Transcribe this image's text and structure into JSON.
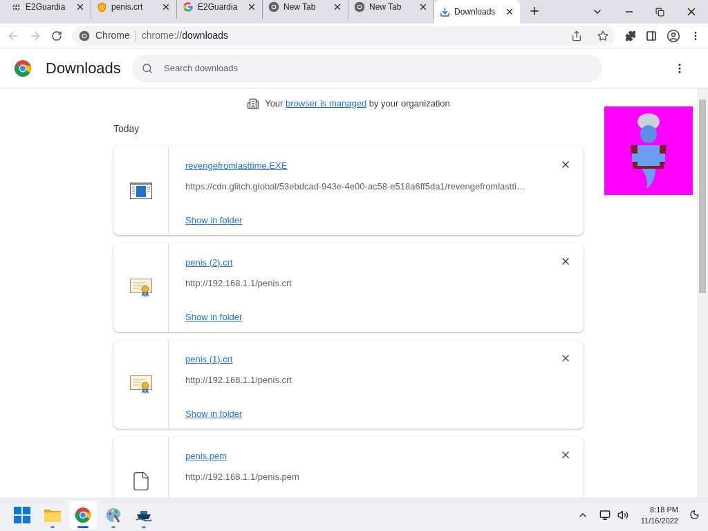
{
  "tabs": [
    {
      "title": "E2Guardia",
      "kind": "globe",
      "selected": false
    },
    {
      "title": "penis.crt",
      "kind": "shield",
      "selected": false
    },
    {
      "title": "E2Guardia",
      "kind": "google",
      "selected": false
    },
    {
      "title": "New Tab",
      "kind": "chrome",
      "selected": false
    },
    {
      "title": "New Tab",
      "kind": "chrome",
      "selected": false
    },
    {
      "title": "Downloads",
      "kind": "download",
      "selected": true
    }
  ],
  "address_bar": {
    "site_label": "Chrome",
    "url_scheme": "chrome://",
    "url_host": "downloads"
  },
  "header": {
    "title": "Downloads",
    "search": {
      "placeholder": "Search downloads"
    }
  },
  "managed_notice": {
    "before": "Your",
    "link": "browser is managed",
    "after": "by your organization"
  },
  "section_label": "Today",
  "downloads": [
    {
      "kind": "exe",
      "name": "revengefromlasttime.EXE",
      "url": "https://cdn.glitch.global/53ebdcad-943e-4e00-ac58-e518a6ff5da1/revengefromlastti…",
      "action": "Show in folder"
    },
    {
      "kind": "certificate",
      "name": "penis (2).crt",
      "url": "http://192.168.1.1/penis.crt",
      "action": "Show in folder"
    },
    {
      "kind": "certificate",
      "name": "penis (1).crt",
      "url": "http://192.168.1.1/penis.crt",
      "action": "Show in folder"
    },
    {
      "kind": "file",
      "name": "penis.pem",
      "url": "http://192.168.1.1/penis.pem"
    }
  ],
  "taskbar": {
    "apps": [
      {
        "kind": "folder",
        "selected": false
      },
      {
        "kind": "chrome",
        "selected": true
      },
      {
        "kind": "paint",
        "selected": false
      },
      {
        "kind": "ship",
        "selected": false
      }
    ],
    "time": "8:18 PM",
    "date": "11/16/2022"
  }
}
